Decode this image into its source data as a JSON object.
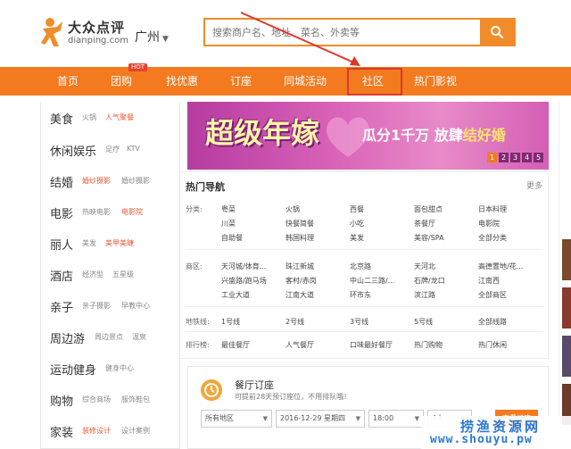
{
  "header": {
    "logo_cn": "大众点评",
    "logo_en": "dianping.com",
    "city": "广州",
    "search_placeholder": "搜索商户名、地址、菜名、外卖等"
  },
  "nav": {
    "items": [
      {
        "label": "首页"
      },
      {
        "label": "团购",
        "tag": "HOT"
      },
      {
        "label": "找优惠"
      },
      {
        "label": "订座"
      },
      {
        "label": "同城活动"
      },
      {
        "label": "社区"
      },
      {
        "label": "热门影视"
      }
    ],
    "highlighted": "社区",
    "highlight_color": "#d93a2b"
  },
  "sidebar": {
    "categories": [
      {
        "label": "美食",
        "subs": [
          {
            "t": "火锅",
            "hot": false
          },
          {
            "t": "人气聚餐",
            "hot": true
          }
        ]
      },
      {
        "label": "休闲娱乐",
        "subs": [
          {
            "t": "足疗",
            "hot": false
          },
          {
            "t": "KTV",
            "hot": false
          }
        ]
      },
      {
        "label": "结婚",
        "subs": [
          {
            "t": "婚纱摄影",
            "hot": true
          },
          {
            "t": "婚纱摄影",
            "hot": false
          }
        ]
      },
      {
        "label": "电影",
        "subs": [
          {
            "t": "热映电影",
            "hot": false
          },
          {
            "t": "电影院",
            "hot": true
          }
        ]
      },
      {
        "label": "丽人",
        "subs": [
          {
            "t": "美发",
            "hot": false
          },
          {
            "t": "美甲美睫",
            "hot": true
          }
        ]
      },
      {
        "label": "酒店",
        "subs": [
          {
            "t": "经济型",
            "hot": false
          },
          {
            "t": "五星级",
            "hot": false
          }
        ]
      },
      {
        "label": "亲子",
        "subs": [
          {
            "t": "亲子摄影",
            "hot": false
          },
          {
            "t": "早教中心",
            "hot": false
          }
        ]
      },
      {
        "label": "周边游",
        "subs": [
          {
            "t": "周边景点",
            "hot": false
          },
          {
            "t": "温泉",
            "hot": false
          }
        ]
      },
      {
        "label": "运动健身",
        "subs": [
          {
            "t": "健身中心",
            "hot": false
          }
        ]
      },
      {
        "label": "购物",
        "subs": [
          {
            "t": "综合商场",
            "hot": false
          },
          {
            "t": "服饰鞋包",
            "hot": false
          }
        ]
      },
      {
        "label": "家装",
        "subs": [
          {
            "t": "装修设计",
            "hot": true
          },
          {
            "t": "设计案例",
            "hot": false
          }
        ]
      }
    ]
  },
  "banner": {
    "big": "超级年嫁",
    "sub_plain": "瓜分1千万 放肆",
    "sub_highlight": "结好婚",
    "pages": [
      "1",
      "2",
      "3",
      "4",
      "5"
    ]
  },
  "hotnav": {
    "title": "热门导航",
    "more": "更多",
    "rows": [
      {
        "label": "分类:",
        "links": [
          "粤菜",
          "火锅",
          "西餐",
          "面包甜点",
          "日本料理",
          "川菜",
          "快餐简餐",
          "小吃",
          "茶餐厅",
          "电影院",
          "自助餐",
          "韩国料理",
          "美发",
          "美容/SPA",
          "全部分类"
        ]
      },
      {
        "label": "商区:",
        "links": [
          "天河城/体育...",
          "珠江新城",
          "北京路",
          "天河北",
          "高德置地/花...",
          "兴盛路/跑马场",
          "客村/赤岗",
          "中山二三路/...",
          "石牌/龙口",
          "江南西",
          "工业大道",
          "江南大道",
          "环市东",
          "滨江路",
          "全部商区"
        ]
      },
      {
        "label": "地铁线:",
        "links": [
          "1号线",
          "2号线",
          "3号线",
          "5号线",
          "全部线路"
        ]
      },
      {
        "label": "排行榜:",
        "links": [
          "最佳餐厅",
          "人气餐厅",
          "口味最好餐厅",
          "热门购物",
          "热门休闲"
        ]
      }
    ]
  },
  "reserve": {
    "title": "餐厅订座",
    "tip": "可提前28天预订座位，不用排队哦！",
    "area": "所有地区",
    "date": "2016-12-29 星期四",
    "time": "18:00",
    "people": "4人",
    "button": "查看订座"
  },
  "watermark": {
    "cn": "捞渔资源网",
    "url": "www.shouyu.pw"
  },
  "colors": {
    "brand_orange": "#f37a1f",
    "banner_pink": "#d862b7",
    "watermark_blue": "#1c6fcf"
  }
}
